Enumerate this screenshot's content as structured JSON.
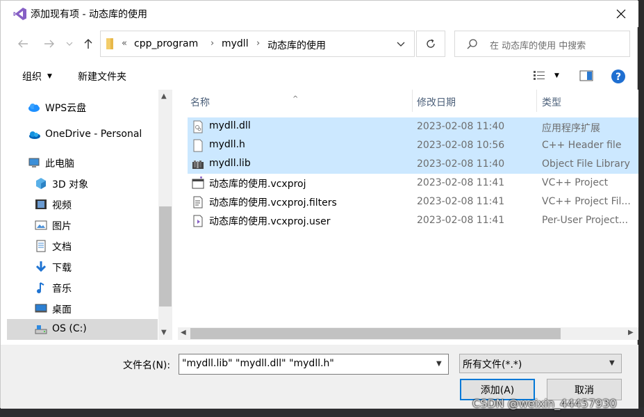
{
  "window": {
    "title": "添加现有项 - 动态库的使用",
    "accent": "#0078d7"
  },
  "nav": {
    "breadcrumb_prefix": "«",
    "crumbs": [
      "cpp_program",
      "mydll",
      "动态库的使用"
    ],
    "separator": "›",
    "search_placeholder": "在 动态库的使用 中搜索"
  },
  "toolbar": {
    "organize_label": "组织",
    "organize_arrow": "▼",
    "new_folder_label": "新建文件夹",
    "view_arrow": "▼"
  },
  "sidebar": {
    "items": [
      {
        "label": "WPS云盘",
        "icon": "cloud-icon"
      },
      {
        "label": "OneDrive - Personal",
        "icon": "onedrive-icon"
      },
      {
        "label": "此电脑",
        "icon": "computer-icon"
      },
      {
        "label": "3D 对象",
        "icon": "cube-icon"
      },
      {
        "label": "视频",
        "icon": "video-icon"
      },
      {
        "label": "图片",
        "icon": "picture-icon"
      },
      {
        "label": "文档",
        "icon": "document-icon"
      },
      {
        "label": "下载",
        "icon": "download-icon"
      },
      {
        "label": "音乐",
        "icon": "music-icon"
      },
      {
        "label": "桌面",
        "icon": "desktop-icon"
      },
      {
        "label": "OS (C:)",
        "icon": "drive-icon",
        "selected": true
      }
    ]
  },
  "filelist": {
    "columns": {
      "name": "名称",
      "date": "修改日期",
      "type": "类型"
    },
    "files": [
      {
        "name": "mydll.dll",
        "date": "2023-02-08 11:40",
        "type": "应用程序扩展",
        "selected": true,
        "icon": "dll-file-icon"
      },
      {
        "name": "mydll.h",
        "date": "2023-02-08 10:56",
        "type": "C++ Header file",
        "selected": true,
        "icon": "header-file-icon"
      },
      {
        "name": "mydll.lib",
        "date": "2023-02-08 11:40",
        "type": "Object File Library",
        "selected": true,
        "icon": "lib-file-icon"
      },
      {
        "name": "动态库的使用.vcxproj",
        "date": "2023-02-08 11:41",
        "type": "VC++ Project",
        "selected": false,
        "icon": "vcxproj-file-icon"
      },
      {
        "name": "动态库的使用.vcxproj.filters",
        "date": "2023-02-08 11:41",
        "type": "VC++ Project Fil...",
        "selected": false,
        "icon": "filters-file-icon"
      },
      {
        "name": "动态库的使用.vcxproj.user",
        "date": "2023-02-08 11:41",
        "type": "Per-User Project...",
        "selected": false,
        "icon": "user-file-icon"
      }
    ]
  },
  "bottom": {
    "filename_label": "文件名(N):",
    "filename_value": "\"mydll.lib\" \"mydll.dll\" \"mydll.h\"",
    "filter_value": "所有文件(*.*)",
    "add_label": "添加(A)",
    "cancel_label": "取消"
  },
  "watermark": "CSDN @weixin_44457930"
}
